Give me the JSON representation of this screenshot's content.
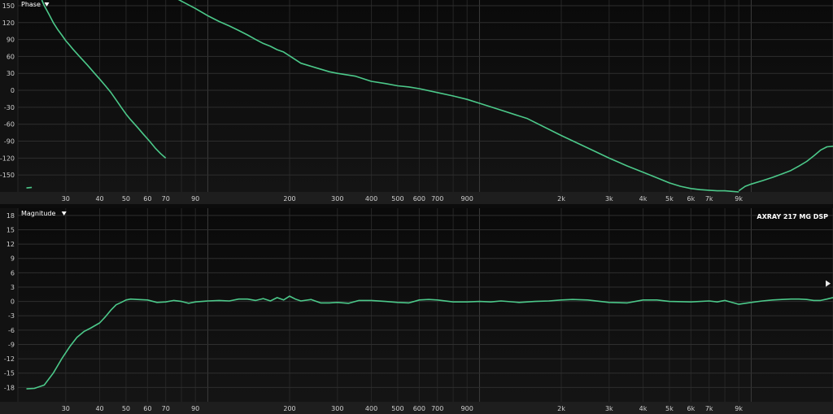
{
  "chart_data": [
    {
      "type": "line",
      "title": "Phase",
      "menu_icon": "caret-down-icon",
      "xscale": "log",
      "xlim": [
        20,
        20000
      ],
      "ylim": [
        -180,
        160
      ],
      "xticks": [
        30,
        40,
        50,
        60,
        70,
        90,
        200,
        300,
        400,
        500,
        600,
        700,
        900,
        2000,
        3000,
        4000,
        5000,
        6000,
        7000,
        9000
      ],
      "xtick_labels": [
        "30",
        "40",
        "50",
        "60",
        "70",
        "90",
        "200",
        "300",
        "400",
        "500",
        "600",
        "700",
        "900",
        "2k",
        "3k",
        "4k",
        "5k",
        "6k",
        "7k",
        "9k"
      ],
      "yticks": [
        150,
        120,
        90,
        60,
        30,
        0,
        -30,
        -60,
        -90,
        -120,
        -150
      ],
      "ytick_labels": [
        "150",
        "120",
        "90",
        "60",
        "30",
        "0",
        "-30",
        "-60",
        "-90",
        "-120",
        "-150"
      ],
      "color": "#4cc98a",
      "series": [
        {
          "x": [
            21.5,
            22.5
          ],
          "y": [
            -173,
            -172
          ]
        },
        {
          "x": [
            24.5,
            25,
            26,
            27,
            28,
            29,
            30,
            31,
            32,
            34,
            36,
            38,
            40,
            42,
            44,
            46,
            48,
            50,
            52,
            55,
            58,
            61,
            64,
            67,
            70
          ],
          "y": [
            160,
            150,
            135,
            120,
            108,
            98,
            88,
            80,
            72,
            58,
            45,
            32,
            20,
            8,
            -4,
            -17,
            -30,
            -42,
            -52,
            -65,
            -78,
            -90,
            -102,
            -112,
            -120
          ]
        },
        {
          "x": [
            55,
            60,
            65,
            70,
            75,
            80,
            90,
            100,
            110,
            120,
            130,
            140,
            150,
            160,
            170,
            180,
            190,
            200,
            220,
            250,
            280,
            300,
            350,
            400,
            450,
            500,
            550,
            600,
            700,
            800,
            900,
            1000,
            1200,
            1500,
            2000,
            2500,
            3000,
            3500,
            4000,
            4500,
            5000,
            5500,
            6000,
            6500,
            7000,
            7500,
            8000,
            8500,
            9000
          ],
          "y": [
            230,
            205,
            190,
            175,
            165,
            158,
            145,
            132,
            122,
            114,
            106,
            98,
            90,
            83,
            78,
            72,
            68,
            61,
            48,
            40,
            33,
            30,
            25,
            16,
            12,
            8,
            6,
            3,
            -4,
            -10,
            -16,
            -23,
            -35,
            -50,
            -80,
            -102,
            -120,
            -134,
            -145,
            -155,
            -164,
            -170,
            -174,
            -176,
            -177,
            -178,
            -178,
            -179,
            -180
          ]
        },
        {
          "x": [
            9000,
            9500,
            10000,
            11000,
            12000,
            13000,
            14000,
            15000,
            16000,
            17000,
            18000,
            19000,
            20000
          ],
          "y": [
            -178,
            -170,
            -166,
            -160,
            -154,
            -148,
            -142,
            -134,
            -126,
            -116,
            -106,
            -100,
            -99
          ]
        }
      ]
    },
    {
      "type": "line",
      "title": "Magnitude",
      "menu_icon": "caret-down-icon",
      "chart_name": "AXRAY 217 MG DSP",
      "xscale": "log",
      "xlim": [
        20,
        20000
      ],
      "ylim": [
        -21,
        19.5
      ],
      "xticks": [
        30,
        40,
        50,
        60,
        70,
        90,
        200,
        300,
        400,
        500,
        600,
        700,
        900,
        2000,
        3000,
        4000,
        5000,
        6000,
        7000,
        9000
      ],
      "xtick_labels": [
        "30",
        "40",
        "50",
        "60",
        "70",
        "90",
        "200",
        "300",
        "400",
        "500",
        "600",
        "700",
        "900",
        "2k",
        "3k",
        "4k",
        "5k",
        "6k",
        "7k",
        "9k"
      ],
      "yticks": [
        18,
        15,
        12,
        9,
        6,
        3,
        0,
        -3,
        -6,
        -9,
        -12,
        -15,
        -18
      ],
      "ytick_labels": [
        "18",
        "15",
        "12",
        "9",
        "6",
        "3",
        "0",
        "-3",
        "-6",
        "-9",
        "-12",
        "-15",
        "-18"
      ],
      "color": "#4cc98a",
      "series": [
        {
          "x": [
            21.5,
            23,
            25,
            27,
            29,
            31,
            33,
            35,
            37,
            40,
            42,
            44,
            46,
            48,
            50,
            52,
            55,
            60,
            65,
            70,
            75,
            80,
            85,
            90,
            100,
            110,
            120,
            130,
            140,
            150,
            160,
            170,
            180,
            190,
            200,
            210,
            220,
            240,
            260,
            280,
            300,
            330,
            360,
            400,
            450,
            500,
            550,
            600,
            650,
            700,
            800,
            900,
            1000,
            1100,
            1200,
            1400,
            1600,
            1800,
            2000,
            2200,
            2500,
            3000,
            3500,
            4000,
            4500,
            5000,
            6000,
            7000,
            7500,
            8000,
            9000,
            10000,
            11000,
            12000,
            13000,
            14000,
            15000,
            16000,
            17000,
            18000,
            19000,
            20000
          ],
          "y": [
            -18.3,
            -18.2,
            -17.5,
            -15,
            -12,
            -9.5,
            -7.5,
            -6.3,
            -5.6,
            -4.5,
            -3.2,
            -1.8,
            -0.7,
            -0.2,
            0.3,
            0.5,
            0.4,
            0.3,
            -0.2,
            -0.1,
            0.2,
            0,
            -0.4,
            -0.1,
            0.1,
            0.2,
            0.1,
            0.5,
            0.5,
            0.2,
            0.6,
            0.1,
            0.8,
            0.3,
            1.1,
            0.5,
            0.1,
            0.4,
            -0.3,
            -0.3,
            -0.2,
            -0.4,
            0.2,
            0.2,
            0,
            -0.2,
            -0.3,
            0.3,
            0.4,
            0.3,
            -0.1,
            -0.1,
            0,
            -0.1,
            0.1,
            -0.2,
            0,
            0.1,
            0.3,
            0.4,
            0.3,
            -0.2,
            -0.3,
            0.3,
            0.3,
            0,
            -0.1,
            0.1,
            -0.1,
            0.2,
            -0.6,
            -0.2,
            0.1,
            0.3,
            0.4,
            0.5,
            0.5,
            0.4,
            0.2,
            0.2,
            0.5,
            0.8
          ]
        }
      ]
    }
  ]
}
